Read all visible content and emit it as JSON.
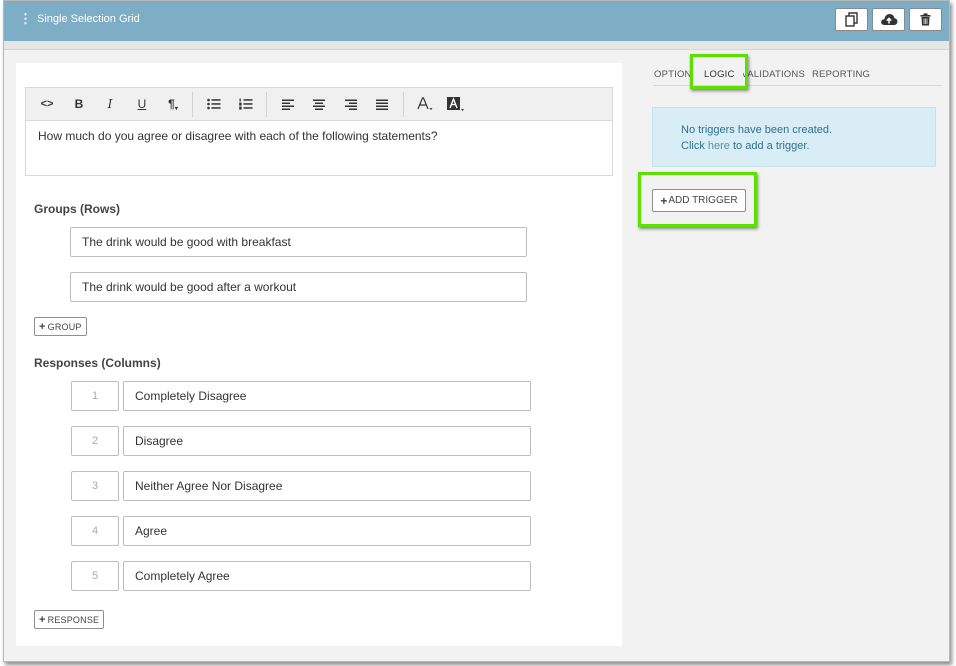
{
  "header": {
    "title": "Single Selection Grid",
    "drag_glyph": "⋮",
    "buttons": [
      "copy-icon",
      "cloud-upload-icon",
      "trash-icon"
    ]
  },
  "toolbar": {
    "source_label": "<>",
    "bold_label": "B",
    "italic_label": "I",
    "underline_label": "U",
    "paragraph_label": "¶"
  },
  "editor": {
    "text": "How much do you agree or disagree with each of the following statements?"
  },
  "groups": {
    "label": "Groups (Rows)",
    "items": [
      "The drink would be good with breakfast",
      "The drink would be good after a workout"
    ],
    "add_label": "GROUP"
  },
  "responses": {
    "label": "Responses (Columns)",
    "items": [
      {
        "value": "1",
        "label": "Completely Disagree"
      },
      {
        "value": "2",
        "label": "Disagree"
      },
      {
        "value": "3",
        "label": "Neither Agree Nor Disagree"
      },
      {
        "value": "4",
        "label": "Agree"
      },
      {
        "value": "5",
        "label": "Completely Agree"
      }
    ],
    "add_label": "RESPONSE"
  },
  "tabs": [
    "OPTIONS",
    "LOGIC",
    "VALIDATIONS",
    "REPORTING"
  ],
  "active_tab": "LOGIC",
  "logic": {
    "message_line1": "No triggers have been created.",
    "message_click": "Click",
    "message_link": "here",
    "message_rest": "to add a trigger.",
    "add_trigger_label": "ADD TRIGGER"
  },
  "colors": {
    "header": "#7eaec6",
    "highlight": "#5ce000",
    "info_bg": "#d9edf6",
    "info_text": "#31708f"
  }
}
